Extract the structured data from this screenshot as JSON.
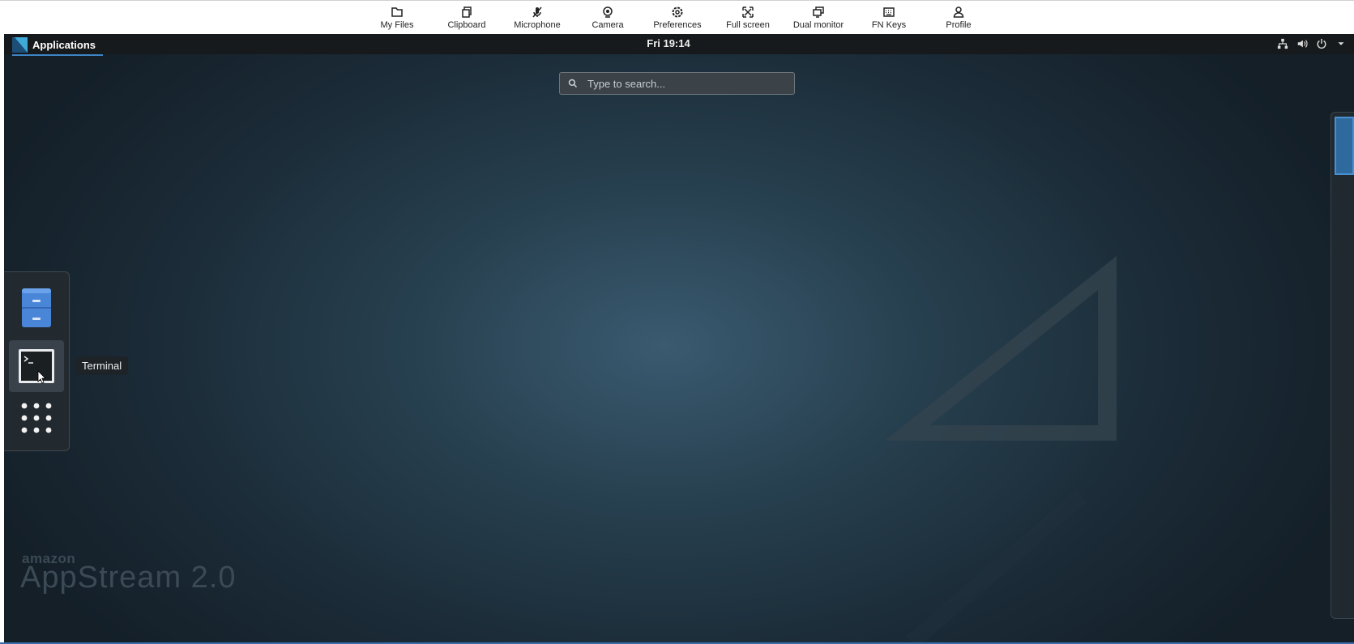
{
  "toolbar": {
    "items": [
      {
        "label": "My Files",
        "icon": "folder-icon"
      },
      {
        "label": "Clipboard",
        "icon": "clipboard-icon"
      },
      {
        "label": "Microphone",
        "icon": "microphone-muted-icon"
      },
      {
        "label": "Camera",
        "icon": "camera-icon"
      },
      {
        "label": "Preferences",
        "icon": "gear-icon"
      },
      {
        "label": "Full screen",
        "icon": "fullscreen-icon"
      },
      {
        "label": "Dual monitor",
        "icon": "dual-monitor-icon"
      },
      {
        "label": "FN Keys",
        "icon": "keyboard-icon"
      },
      {
        "label": "Profile",
        "icon": "user-icon"
      }
    ]
  },
  "topbar": {
    "apps_label": "Applications",
    "clock": "Fri 19:14",
    "tray": [
      "network-icon",
      "volume-icon",
      "power-icon",
      "chevron-down-icon"
    ]
  },
  "search": {
    "placeholder": "Type to search..."
  },
  "dash": {
    "items": [
      "files-icon",
      "terminal-icon",
      "show-apps-icon"
    ],
    "tooltip": "Terminal"
  },
  "watermark": {
    "amazon": "amazon",
    "product": "AppStream 2.0"
  },
  "colors": {
    "accent": "#3d85c6",
    "topbar_bg": "#171a1c"
  }
}
